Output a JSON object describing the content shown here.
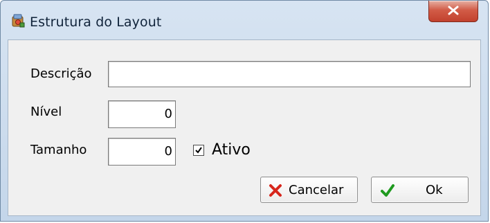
{
  "window": {
    "title": "Estrutura do Layout",
    "close_icon": "close-x-icon",
    "app_icon": "layout-structure-icon"
  },
  "form": {
    "descricao": {
      "label": "Descrição",
      "value": ""
    },
    "nivel": {
      "label": "Nível",
      "value": "0"
    },
    "tamanho": {
      "label": "Tamanho",
      "value": "0"
    },
    "ativo": {
      "label": "Ativo",
      "checked": true
    }
  },
  "buttons": {
    "cancel": {
      "label": "Cancelar",
      "icon": "red-x-icon"
    },
    "ok": {
      "label": "Ok",
      "icon": "green-check-icon"
    }
  },
  "colors": {
    "titlebar": "#c4d6ea",
    "close_button": "#c2412e",
    "cancel_icon": "#d7261c",
    "ok_icon": "#1f9a1f"
  }
}
